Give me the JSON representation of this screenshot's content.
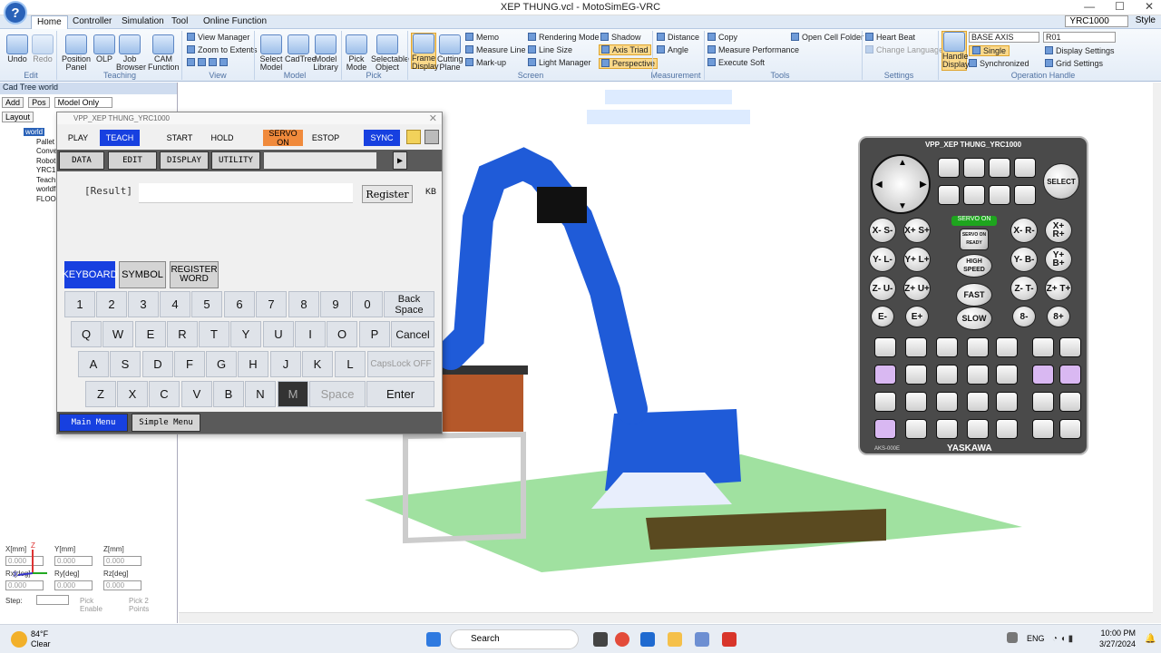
{
  "app": {
    "title": "XEP THUNG.vcl - MotoSimEG-VRC",
    "help": "?"
  },
  "tabs": [
    "Home",
    "Controller",
    "Simulation",
    "Tool",
    "Online Function"
  ],
  "tabs_right": {
    "controller": "YRC1000",
    "style": "Style"
  },
  "ribbon": {
    "groups": [
      "Edit",
      "Teaching",
      "View",
      "Model",
      "Pick",
      "Screen",
      "Measurement",
      "Tools",
      "Settings",
      "Operation Handle"
    ],
    "buttons": [
      "Undo",
      "Redo",
      "Position Panel",
      "OLP",
      "Job Browser",
      "CAM Function",
      "Select Model",
      "CadTree",
      "Model Library",
      "Pick Mode",
      "Selectable Object",
      "Frame Display",
      "Cutting Plane",
      "Handle Display"
    ],
    "small": [
      "View Manager",
      "Zoom to Extents",
      "Memo",
      "Measure Line",
      "Mark-up",
      "Rendering Mode",
      "Line Size",
      "Light Manager",
      "Shadow",
      "Axis Triad",
      "Perspective",
      "Distance",
      "Angle",
      "Copy",
      "Measure Performance",
      "Execute Soft",
      "Open Cell Folder",
      "Heart Beat",
      "Change Language",
      "Single",
      "Synchronized",
      "Display Settings",
      "Grid Settings"
    ],
    "base_axis": "BASE AXIS",
    "r01": "R01"
  },
  "cadtree": {
    "title": "Cad Tree world",
    "buttons": [
      "Add",
      "Pos"
    ],
    "filter": "Model Only",
    "layout": "Layout",
    "items": [
      "world",
      "Pallet",
      "Conve",
      "Robot",
      "YRC1",
      "Teach",
      "worldf",
      "FLOO"
    ]
  },
  "coords": {
    "x": "X[mm]",
    "y": "Y[mm]",
    "z": "Z[mm]",
    "rx": "Rx[deg]",
    "ry": "Ry[deg]",
    "rz": "Rz[deg]",
    "val": "0.000",
    "step": "Step:",
    "pick_enable": "Pick Enable",
    "pick_2": "Pick 2 Points"
  },
  "vpp": {
    "title": "VPP_XEP THUNG_YRC1000",
    "top_buttons": [
      "PLAY",
      "TEACH",
      "START",
      "HOLD",
      "SERVO ON",
      "ESTOP",
      "SYNC"
    ],
    "nav": [
      "DATA",
      "EDIT",
      "DISPLAY",
      "UTILITY"
    ],
    "result_label": "[Result]",
    "register": "Register",
    "kb": "KB",
    "modes": [
      "KEYBOARD",
      "SYMBOL",
      "REGISTER WORD"
    ],
    "row1": [
      "1",
      "2",
      "3",
      "4",
      "5",
      "6",
      "7",
      "8",
      "9",
      "0"
    ],
    "backspace": "Back Space",
    "row2": [
      "Q",
      "W",
      "E",
      "R",
      "T",
      "Y",
      "U",
      "I",
      "O",
      "P"
    ],
    "cancel": "Cancel",
    "row3": [
      "A",
      "S",
      "D",
      "F",
      "G",
      "H",
      "J",
      "K",
      "L"
    ],
    "capslock": "CapsLock OFF",
    "row4": [
      "Z",
      "X",
      "C",
      "V",
      "B",
      "N",
      "M"
    ],
    "space": "Space",
    "enter": "Enter",
    "bottom": [
      "Main Menu",
      "Simple Menu"
    ]
  },
  "pendant": {
    "title": "VPP_XEP THUNG_YRC1000",
    "select": "SELECT",
    "servo_on": "SERVO ON",
    "servo_ready": "SERVO ON READY",
    "high_speed": "HIGH SPEED",
    "fast": "FAST",
    "slow": "SLOW",
    "axes_left": [
      "X- S-",
      "Y- L-",
      "Z- U-",
      "E-"
    ],
    "axes_right": [
      "X+ S+",
      "Y+ L+",
      "Z+ U+",
      "E+"
    ],
    "rot_left": [
      "X- R-",
      "Y- B-",
      "Z- T-",
      "8-"
    ],
    "rot_right": [
      "X+ R+",
      "Y+ B+",
      "Z+ T+",
      "8+"
    ],
    "brand": "YASKAWA",
    "model": "AKS-000E"
  },
  "taskbar": {
    "weather_temp": "84°F",
    "weather_desc": "Clear",
    "search": "Search",
    "lang": "ENG",
    "time": "10:00 PM",
    "date": "3/27/2024"
  }
}
